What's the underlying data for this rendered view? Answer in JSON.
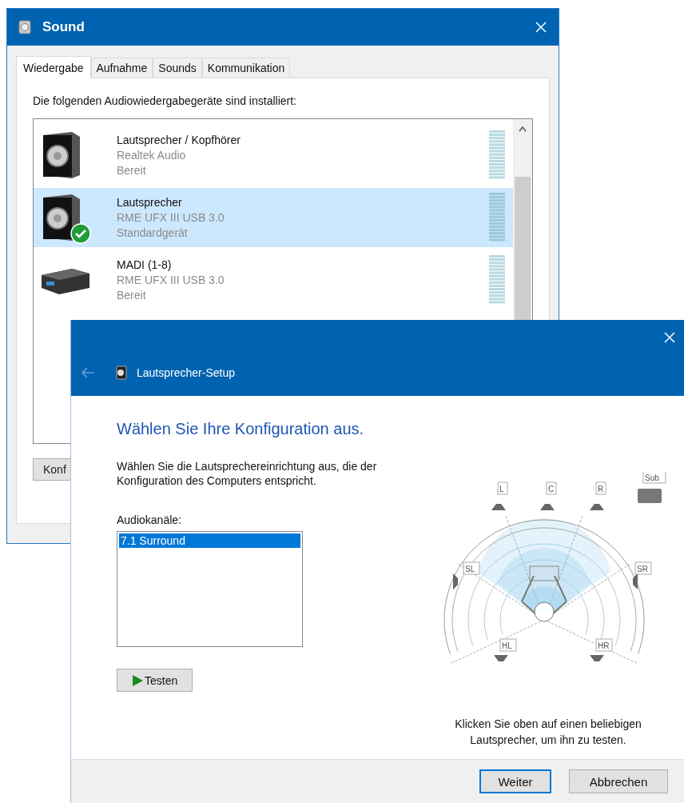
{
  "sound_window": {
    "title": "Sound",
    "tabs": [
      {
        "label": "Wiedergabe",
        "selected": true
      },
      {
        "label": "Aufnahme",
        "selected": false
      },
      {
        "label": "Sounds",
        "selected": false
      },
      {
        "label": "Kommunikation",
        "selected": false
      }
    ],
    "instruction": "Die folgenden Audiowiedergabegeräte sind installiert:",
    "devices": [
      {
        "name": "Lautsprecher / Kopfhörer",
        "driver": "Realtek Audio",
        "status": "Bereit",
        "kind": "speaker",
        "default": false,
        "selected": false
      },
      {
        "name": "Lautsprecher",
        "driver": "RME UFX III USB 3.0",
        "status": "Standardgerät",
        "kind": "speaker",
        "default": true,
        "selected": true
      },
      {
        "name": "MADI (1-8)",
        "driver": "RME UFX III USB 3.0",
        "status": "Bereit",
        "kind": "interface",
        "default": false,
        "selected": false
      }
    ],
    "button": "Konf"
  },
  "setup_window": {
    "title": "Lautsprecher-Setup",
    "heading": "Wählen Sie Ihre Konfiguration aus.",
    "description": "Wählen Sie die Lautsprechereinrichtung aus, die der Konfiguration des Computers entspricht.",
    "channels_label": "Audiokanäle:",
    "channels": [
      {
        "label": "7.1 Surround",
        "selected": true
      }
    ],
    "test_button": "Testen",
    "speakers": [
      {
        "label": "L",
        "kind": "front"
      },
      {
        "label": "C",
        "kind": "front"
      },
      {
        "label": "R",
        "kind": "front"
      },
      {
        "label": "Sub",
        "kind": "sub"
      },
      {
        "label": "SL",
        "kind": "side-left"
      },
      {
        "label": "SR",
        "kind": "side-right"
      },
      {
        "label": "HL",
        "kind": "rear"
      },
      {
        "label": "HR",
        "kind": "rear"
      }
    ],
    "hint": "Klicken Sie oben auf einen beliebigen Lautsprecher, um ihn zu testen.",
    "buttons": [
      {
        "label": "Weiter",
        "kind": "primary"
      },
      {
        "label": "Abbrechen",
        "kind": "secondary"
      }
    ]
  }
}
